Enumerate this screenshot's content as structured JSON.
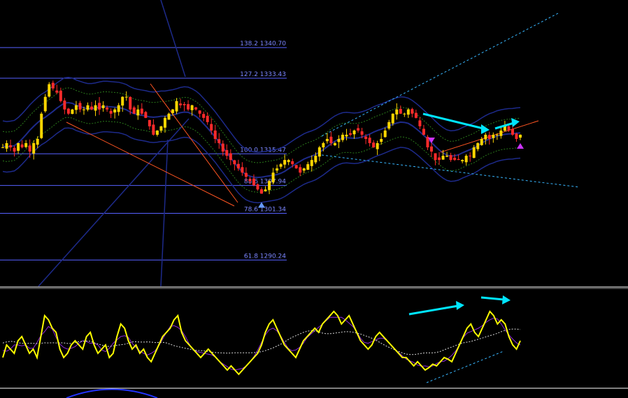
{
  "chart_data": {
    "type": "candlestick",
    "price_axis": {
      "min": 1284,
      "max": 1352
    },
    "osc_axis": {
      "min": 0,
      "max": 100
    },
    "fib_levels": [
      {
        "label": "138.2 1340.70",
        "price": 1340.7
      },
      {
        "label": "127.2 1333.43",
        "price": 1333.43
      },
      {
        "label": "100.0 1315.47",
        "price": 1315.47
      },
      {
        "label": "88.6 1307.94",
        "price": 1307.94
      },
      {
        "label": "78.6 1301.34",
        "price": 1301.34
      },
      {
        "label": "61.8 1290.24",
        "price": 1290.24
      }
    ],
    "close_series": [
      1317,
      1318,
      1317,
      1316,
      1318,
      1317,
      1318,
      1316,
      1318,
      1319,
      1325,
      1329,
      1332,
      1331,
      1330,
      1328,
      1326,
      1325,
      1326,
      1327,
      1326,
      1326,
      1327,
      1326,
      1327,
      1326,
      1327,
      1326,
      1325,
      1326,
      1327,
      1329,
      1329,
      1326,
      1325,
      1326,
      1325,
      1324,
      1322,
      1320,
      1321,
      1322,
      1324,
      1325,
      1326,
      1328,
      1327,
      1327,
      1326,
      1327,
      1326,
      1325,
      1324,
      1323,
      1321,
      1319,
      1318,
      1316,
      1315,
      1314,
      1313,
      1312,
      1311,
      1310,
      1309,
      1308,
      1307,
      1306,
      1307,
      1309,
      1311,
      1312,
      1313,
      1314,
      1314,
      1313,
      1312,
      1311,
      1312,
      1313,
      1314,
      1315,
      1317,
      1318,
      1319,
      1318,
      1318,
      1319,
      1320,
      1320,
      1320,
      1321,
      1321,
      1320,
      1319,
      1318,
      1317,
      1318,
      1319,
      1321,
      1323,
      1325,
      1326,
      1325,
      1325,
      1326,
      1325,
      1324,
      1322,
      1320,
      1317,
      1316,
      1314,
      1314,
      1315,
      1315,
      1314,
      1314,
      1314,
      1314,
      1315,
      1315,
      1317,
      1318,
      1319,
      1320,
      1319,
      1320,
      1320,
      1321,
      1322,
      1321,
      1320,
      1319,
      1320
    ],
    "oscillator_series": [
      30,
      45,
      40,
      35,
      50,
      55,
      45,
      35,
      40,
      30,
      55,
      80,
      75,
      65,
      60,
      40,
      30,
      35,
      45,
      50,
      45,
      40,
      55,
      60,
      45,
      35,
      40,
      45,
      30,
      35,
      55,
      70,
      65,
      50,
      40,
      45,
      35,
      40,
      30,
      25,
      35,
      45,
      55,
      60,
      65,
      75,
      80,
      60,
      50,
      45,
      40,
      35,
      30,
      35,
      40,
      35,
      30,
      25,
      20,
      15,
      20,
      15,
      10,
      15,
      20,
      25,
      30,
      35,
      45,
      60,
      70,
      75,
      65,
      55,
      45,
      40,
      35,
      30,
      40,
      50,
      55,
      60,
      65,
      60,
      70,
      75,
      80,
      85,
      80,
      70,
      75,
      80,
      70,
      60,
      50,
      45,
      40,
      45,
      55,
      60,
      55,
      50,
      45,
      40,
      35,
      30,
      30,
      25,
      20,
      25,
      20,
      15,
      18,
      22,
      20,
      25,
      30,
      28,
      25,
      35,
      45,
      55,
      65,
      70,
      60,
      55,
      65,
      75,
      85,
      80,
      70,
      75,
      70,
      55,
      45,
      40,
      50
    ],
    "markers": [
      {
        "type": "arrow-up",
        "color": "#6699ff",
        "at_index": 67
      },
      {
        "type": "arrow-down",
        "color": "#cc33ff",
        "at_index": 111
      },
      {
        "type": "arrow-up",
        "color": "#cc33ff",
        "at_index": 134
      },
      {
        "type": "arrow-down",
        "color": "#cc33ff",
        "at_index": 146
      }
    ],
    "colors": {
      "background": "#000000",
      "candle_up": "#ffd600",
      "candle_down": "#ff2b2b",
      "fib_line": "#5660ff",
      "trend_orange": "#ff5522",
      "trend_cyan": "#38b6ff",
      "signal_arrow": "#00e5ff",
      "envelope": "#1d2a8a",
      "bollinger": "#2a7a1a",
      "oscillator_main": "#ffff00",
      "oscillator_signal": "#8e2bd6",
      "oscillator_ma": "#d9d9d9",
      "separator": "#ffffff"
    }
  }
}
